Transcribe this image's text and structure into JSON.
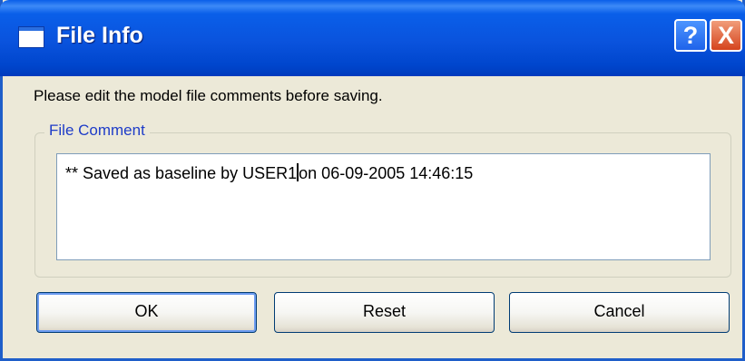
{
  "window": {
    "title": "File Info",
    "help_label": "?",
    "close_label": "X"
  },
  "prompt_text": "Please edit the model file comments before saving.",
  "group": {
    "label": "File Comment"
  },
  "comment": {
    "before_caret": "** Saved as baseline by USER1",
    "after_caret": "on 06-09-2005 14:46:15"
  },
  "buttons": {
    "ok": "OK",
    "reset": "Reset",
    "cancel": "Cancel"
  },
  "colors": {
    "titlebar": "#0a53dd",
    "dialog_background": "#ece9d8",
    "group_label": "#1e3cc8",
    "close_button": "#d5441e"
  }
}
